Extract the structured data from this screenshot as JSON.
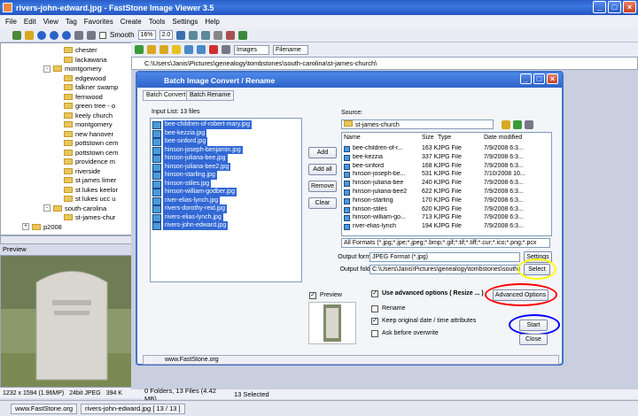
{
  "window": {
    "title": "rivers-john-edward.jpg  -  FastStone Image Viewer 3.5"
  },
  "menu": [
    "File",
    "Edit",
    "View",
    "Tag",
    "Favorites",
    "Create",
    "Tools",
    "Settings",
    "Help"
  ],
  "toolbar": {
    "smooth_label": "Smooth",
    "zoom": "16%",
    "ratio": "2.0"
  },
  "toolbar2": {
    "filter": "Images",
    "sort": "Filename"
  },
  "address": "C:\\Users\\Janis\\Pictures\\genealogy\\tombstones\\south-carolina\\st-james-church\\",
  "tree": [
    {
      "label": "chester",
      "indent": 78,
      "exp": ""
    },
    {
      "label": "lackawana",
      "indent": 78,
      "exp": ""
    },
    {
      "label": "montgomery",
      "indent": 66,
      "exp": "-"
    },
    {
      "label": "edgewood",
      "indent": 78,
      "exp": ""
    },
    {
      "label": "falkner swamp",
      "indent": 78,
      "exp": ""
    },
    {
      "label": "fernwood",
      "indent": 78,
      "exp": ""
    },
    {
      "label": "green tree - o",
      "indent": 78,
      "exp": ""
    },
    {
      "label": "keely church",
      "indent": 78,
      "exp": ""
    },
    {
      "label": "montgomery",
      "indent": 78,
      "exp": ""
    },
    {
      "label": "new hanover",
      "indent": 78,
      "exp": ""
    },
    {
      "label": "pottstown cem",
      "indent": 78,
      "exp": ""
    },
    {
      "label": "pottstown cem",
      "indent": 78,
      "exp": ""
    },
    {
      "label": "providence m",
      "indent": 78,
      "exp": ""
    },
    {
      "label": "riverside",
      "indent": 78,
      "exp": ""
    },
    {
      "label": "st james limer",
      "indent": 78,
      "exp": ""
    },
    {
      "label": "st lukes keelor",
      "indent": 78,
      "exp": ""
    },
    {
      "label": "st lukes ucc u",
      "indent": 78,
      "exp": ""
    },
    {
      "label": "south-carolina",
      "indent": 66,
      "exp": "-"
    },
    {
      "label": "st-james-chur",
      "indent": 78,
      "exp": ""
    },
    {
      "label": "p2008",
      "indent": 42,
      "exp": "+"
    }
  ],
  "preview_label": "Preview",
  "status_left": {
    "dims": "1232 x 1594 (1.96MP)",
    "bits": "24bit JPEG",
    "size": "394 K"
  },
  "status_mid": {
    "folders": "0 Folders, 13 Files (4.42 MB)",
    "selected": "13 Selected"
  },
  "status_bottom": {
    "site": "www.FastStone.org",
    "file": "rivers-john-edward.jpg [ 13 / 13 ]"
  },
  "dialog": {
    "title": "Batch Image Convert / Rename",
    "tabs": [
      "Batch Convert",
      "Batch Rename"
    ],
    "input_list_label": "Input List:  13 files",
    "input_files": [
      "bee-children-of-robert-mary.jpg",
      "bee-kezzia.jpg",
      "bee-sinford.jpg",
      "hinson-joseph-benjamin.jpg",
      "hinson-juliana-bee.jpg",
      "hinson-juliana-bee2.jpg",
      "hinson-starling.jpg",
      "hinson-stiles.jpg",
      "hinson-william-godber.jpg",
      "river-elias-lynch.jpg",
      "rivers-dorothy-reid.jpg",
      "rivers-elias-lynch.jpg",
      "rivers-john-edward.jpg"
    ],
    "buttons": {
      "add": "Add",
      "add_all": "Add all",
      "remove": "Remove",
      "clear": "Clear",
      "settings": "Settings",
      "select": "Select",
      "advanced": "Advanced Options",
      "start": "Start",
      "close": "Close"
    },
    "source_label": "Source:",
    "source_folder": "st-james-church",
    "columns": [
      "Name",
      "Size",
      "Type",
      "Date modified"
    ],
    "source_files": [
      [
        "bee-children-of-r...",
        "163 KB",
        "JPG File",
        "7/9/2008 6:3..."
      ],
      [
        "bee-kezzia",
        "337 KB",
        "JPG File",
        "7/9/2008 6:3..."
      ],
      [
        "bee-sinford",
        "168 KB",
        "JPG File",
        "7/9/2008 6:3..."
      ],
      [
        "hinson-joseph-be...",
        "531 KB",
        "JPG File",
        "7/10/2008 10..."
      ],
      [
        "hinson-juliana-bee",
        "240 KB",
        "JPG File",
        "7/9/2008 6:3..."
      ],
      [
        "hinson-juliana-bee2",
        "622 KB",
        "JPG File",
        "7/9/2008 6:3..."
      ],
      [
        "hinson-starling",
        "170 KB",
        "JPG File",
        "7/9/2008 6:3..."
      ],
      [
        "hinson-stiles",
        "620 KB",
        "JPG File",
        "7/9/2008 6:3..."
      ],
      [
        "hinson-william-go...",
        "713 KB",
        "JPG File",
        "7/9/2008 6:3..."
      ],
      [
        "river-elias-lynch",
        "194 KB",
        "JPG File",
        "7/9/2008 6:3..."
      ]
    ],
    "formats": "All Formats (*.jpg;*.jpe;*.jpeg;*.bmp;*.gif;*.tif;*.tiff;*.cur;*.ico;*.png;*.pcx",
    "output_format_label": "Output format:",
    "output_format": "JPEG Format (*.jpg)",
    "output_folder_label": "Output folder:",
    "output_folder": "C:\\Users\\Janis\\Pictures\\genealogy\\tombstones\\south-caro",
    "preview_label": "Preview",
    "use_advanced": "Use advanced options ( Resize ... )",
    "rename": "Rename",
    "keep_date": "Keep original date / time attributes",
    "ask_overwrite": "Ask before overwrite",
    "site": "www.FastStone.org"
  },
  "highlights": {
    "select": "#ffff00",
    "advanced": "#ff0000",
    "start": "#0000ff"
  }
}
